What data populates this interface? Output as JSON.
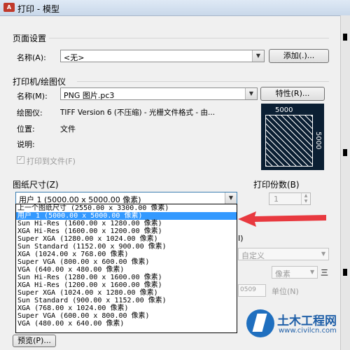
{
  "window": {
    "app_icon": "A",
    "title": "打印 - 模型"
  },
  "page_setup": {
    "section": "页面设置",
    "name_label": "名称(A):",
    "name_value": "<无>",
    "add_button": "添加(.)..."
  },
  "plotter": {
    "section": "打印机/绘图仪",
    "name_label": "名称(M):",
    "name_value": "PNG 图片.pc3",
    "properties_button": "特性(R)...",
    "plotter_label": "绘图仪:",
    "plotter_value": "TIFF Version 6 (不压缩) - 光栅文件格式 - 由...",
    "location_label": "位置:",
    "location_value": "文件",
    "description_label": "说明:",
    "print_to_file": "打印到文件(F)",
    "preview_width": "5000",
    "preview_height": "5000"
  },
  "paper_size": {
    "section": "图纸尺寸(Z)",
    "selected": "用户 1 (5000.00 x 5000.00 像素)",
    "options": [
      "上一个图纸尺寸  (2550.00 x 3300.00 像素)",
      "用户 1 (5000.00 x 5000.00 像素)",
      "Sun Hi-Res (1600.00 x 1280.00 像素)",
      "XGA Hi-Res (1600.00 x 1200.00 像素)",
      "Super XGA (1280.00 x 1024.00 像素)",
      "Sun Standard (1152.00 x 900.00 像素)",
      "XGA (1024.00 x 768.00 像素)",
      "Super VGA (800.00 x 600.00 像素)",
      "VGA (640.00 x 480.00 像素)",
      "Sun Hi-Res (1280.00 x 1600.00 像素)",
      "XGA Hi-Res (1200.00 x 1600.00 像素)",
      "Super XGA (1024.00 x 1280.00 像素)",
      "Sun Standard (900.00 x 1152.00 像素)",
      "XGA (768.00 x 1024.00 像素)",
      "Super VGA (600.00 x 800.00 像素)",
      "VGA (480.00 x 640.00 像素)"
    ]
  },
  "copies": {
    "label": "打印份数(B)",
    "value": "1"
  },
  "background": {
    "custom_text": "自定义",
    "unit_value": "像素",
    "number_value": "0509",
    "unit_label": "单位(N)",
    "i_label": "I)",
    "three_label": "三"
  },
  "footer": {
    "preview_button": "预览(P)..."
  }
}
